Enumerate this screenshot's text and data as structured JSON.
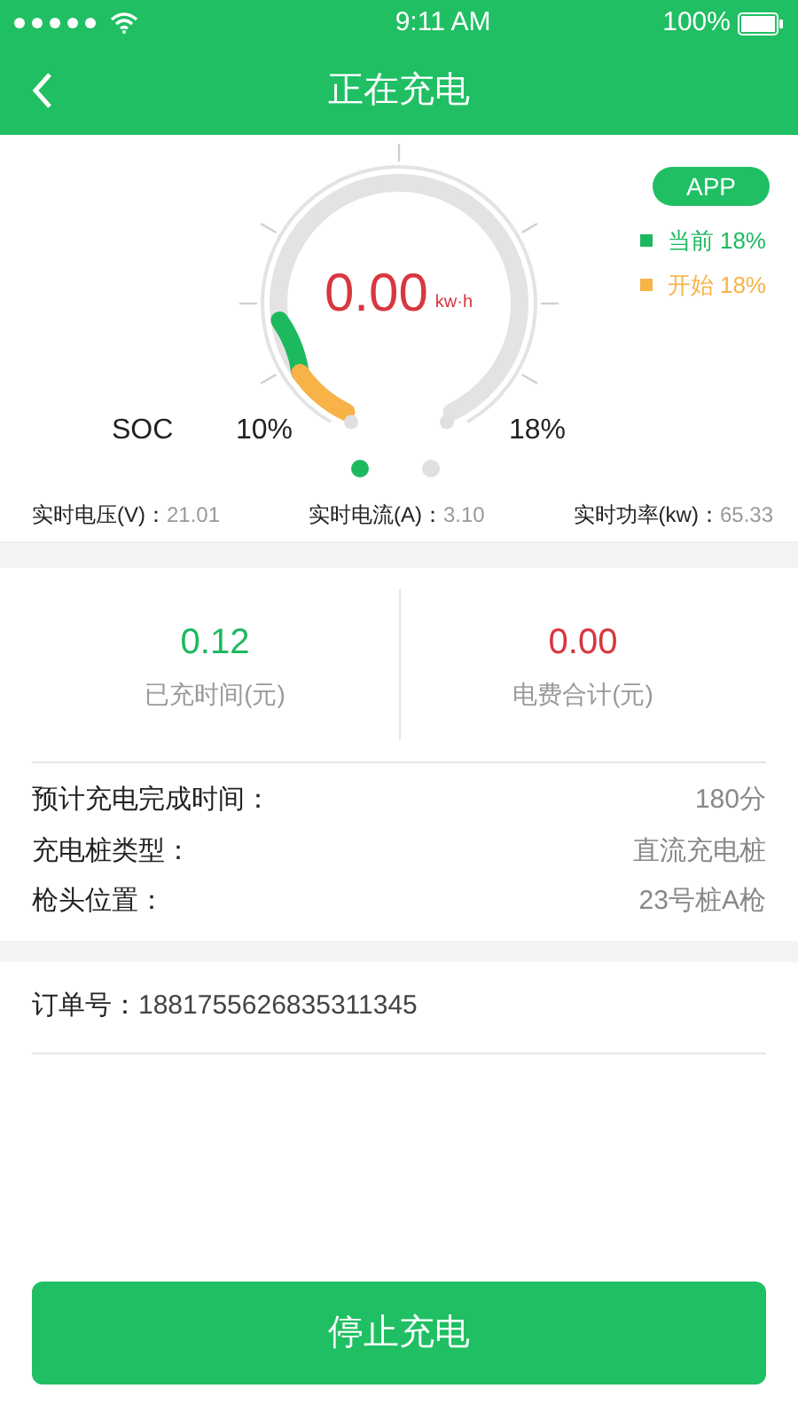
{
  "status_bar": {
    "time": "9:11 AM",
    "battery": "100%"
  },
  "header": {
    "title": "正在充电"
  },
  "gauge": {
    "badge": "APP",
    "value": "0.00",
    "unit": "kw·h",
    "soc_label": "SOC",
    "min_label": "10%",
    "max_label": "18%",
    "legend": [
      {
        "label": "当前 18%",
        "color": "#1db95f"
      },
      {
        "label": "开始 18%",
        "color": "#f7b347"
      }
    ]
  },
  "pager": [
    {
      "selected": true
    },
    {
      "selected": false
    }
  ],
  "readings": [
    {
      "label": "实时电压(V)：",
      "value": "21.01"
    },
    {
      "label": "实时电流(A)：",
      "value": "3.10"
    },
    {
      "label": "实时功率(kw)：",
      "value": "65.33"
    }
  ],
  "stats": [
    {
      "value": "0.12",
      "label": "已充时间(元)",
      "kind": "time"
    },
    {
      "value": "0.00",
      "label": "电费合计(元)",
      "kind": "cost"
    }
  ],
  "details": [
    {
      "label": "预计充电完成时间：",
      "value": "180分"
    },
    {
      "label": "充电桩类型：",
      "value": "直流充电桩"
    },
    {
      "label": "枪头位置：",
      "value": "23号桩A枪"
    }
  ],
  "order": {
    "label": "订单号：",
    "value": "1881755626835311345"
  },
  "stop_button": "停止充电"
}
